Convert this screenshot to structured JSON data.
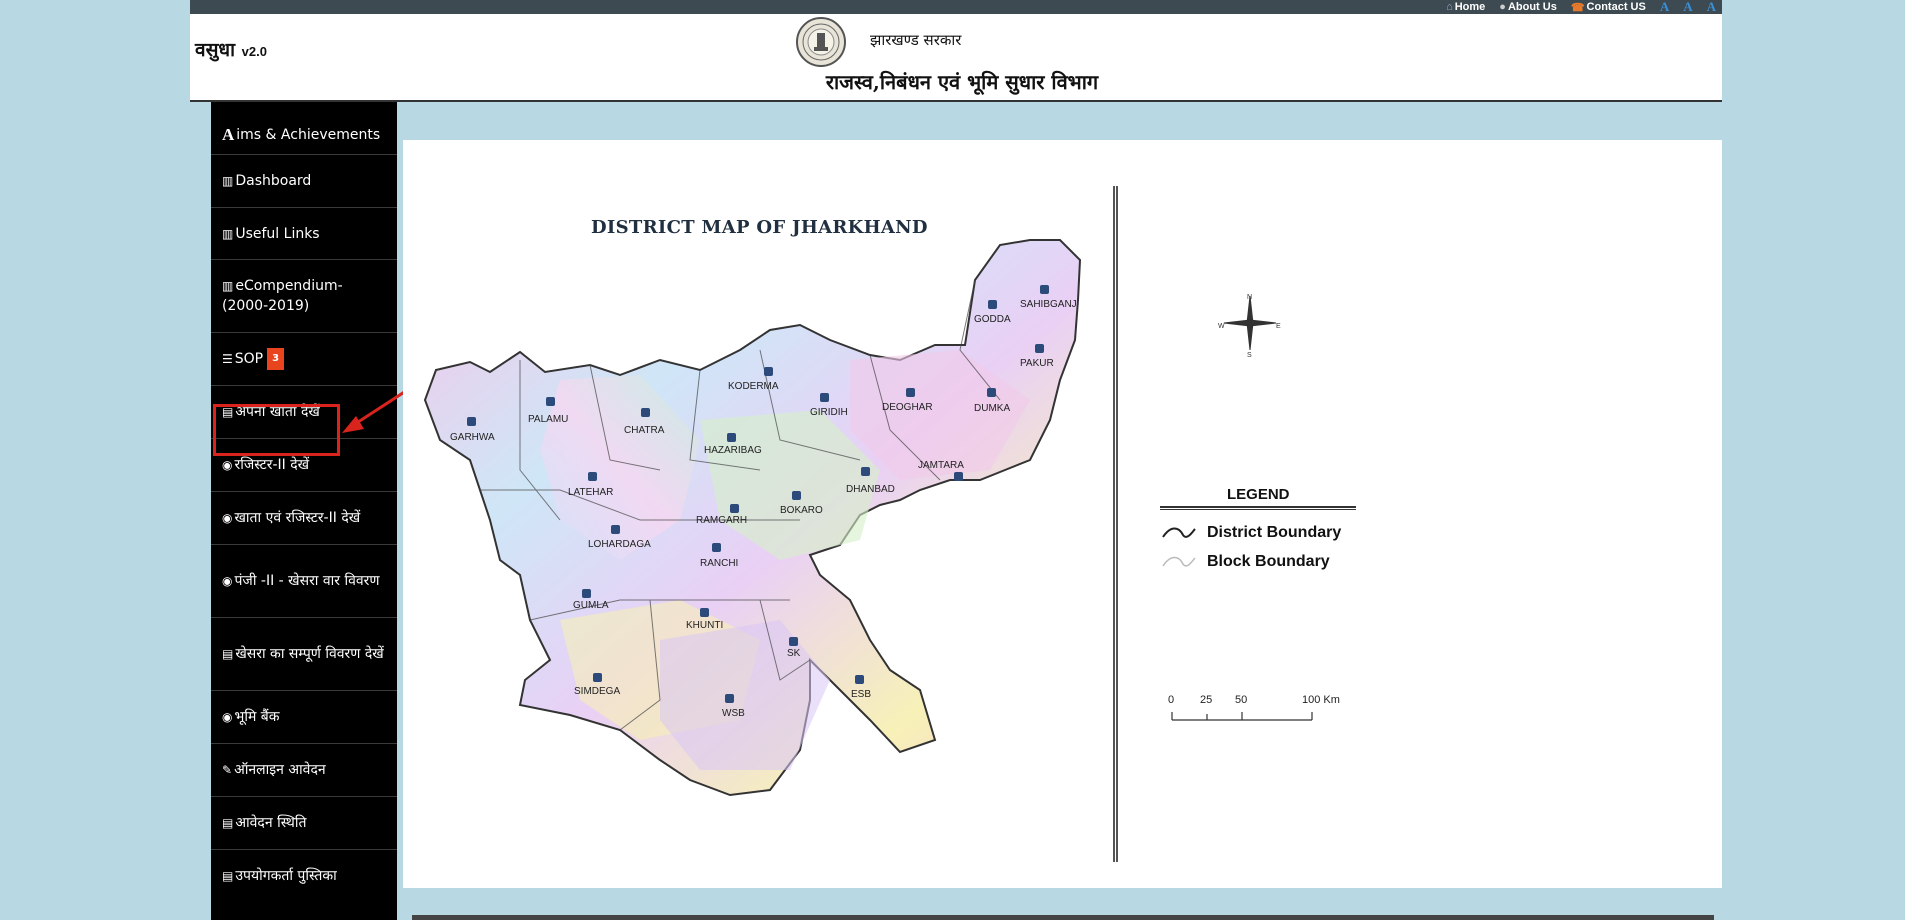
{
  "app": {
    "name": "वसुधा",
    "version": "v2.0"
  },
  "top_nav": [
    {
      "label": "Home",
      "icon": "home-icon"
    },
    {
      "label": "About Us",
      "icon": "user-icon"
    },
    {
      "label": "Contact US",
      "icon": "phone-icon"
    }
  ],
  "font_controls": [
    "A",
    "A",
    "A"
  ],
  "header": {
    "government": "झारखण्ड सरकार",
    "department": "राजस्व,निबंधन एवं भूमि सुधार  विभाग"
  },
  "sidebar": {
    "items": [
      {
        "label": "ims & Achievements",
        "icon": "letter-a-icon",
        "lead": "A"
      },
      {
        "label": "Dashboard",
        "icon": "bar-chart-icon"
      },
      {
        "label": "Useful Links",
        "icon": "bar-chart-icon"
      },
      {
        "label": "eCompendium-(2000-2019)",
        "icon": "bar-chart-icon"
      },
      {
        "label": "SOP",
        "icon": "list-icon",
        "badge": "3"
      },
      {
        "label": "अपना खाता देखें",
        "icon": "table-icon"
      },
      {
        "label": "रजिस्टर-II देखें",
        "icon": "eye-icon"
      },
      {
        "label": "खाता एवं रजिस्टर-II देखें",
        "icon": "eye-icon"
      },
      {
        "label": "पंजी -II - खेसरा वार विवरण",
        "icon": "eye-icon"
      },
      {
        "label": "खेसरा का सम्पूर्ण विवरण देखें",
        "icon": "table-icon"
      },
      {
        "label": "भूमि बैंक",
        "icon": "eye-icon"
      },
      {
        "label": "ऑनलाइन आवेदन",
        "icon": "edit-icon"
      },
      {
        "label": "आवेदन स्थिति",
        "icon": "list-alt-icon"
      },
      {
        "label": "उपयोगकर्ता पुस्तिका",
        "icon": "list-alt-icon"
      }
    ]
  },
  "map": {
    "title": "DISTRICT MAP OF JHARKHAND",
    "districts": [
      "GARHWA",
      "PALAMU",
      "CHATRA",
      "KODERMA",
      "GIRIDIH",
      "DEOGHAR",
      "GODDA",
      "SAHIBGANJ",
      "PAKUR",
      "DUMKA",
      "JAMTARA",
      "DHANBAD",
      "BOKARO",
      "HAZARIBAG",
      "LATEHAR",
      "LOHARDAGA",
      "RAMGARH",
      "RANCHI",
      "GUMLA",
      "KHUNTI",
      "SIMDEGA",
      "SK",
      "WSB",
      "ESB"
    ],
    "compass": {
      "n": "N",
      "s": "S",
      "e": "E",
      "w": "W"
    },
    "legend": {
      "title": "LEGEND",
      "entries": [
        "District Boundary",
        "Block Boundary"
      ]
    },
    "scale": {
      "ticks": [
        "0",
        "25",
        "50",
        "100 Km"
      ]
    }
  },
  "colors": {
    "sidebar_bg": "#000000",
    "page_bg": "#b8d8e3",
    "highlight": "#d9231d",
    "badge": "#e8451f"
  }
}
